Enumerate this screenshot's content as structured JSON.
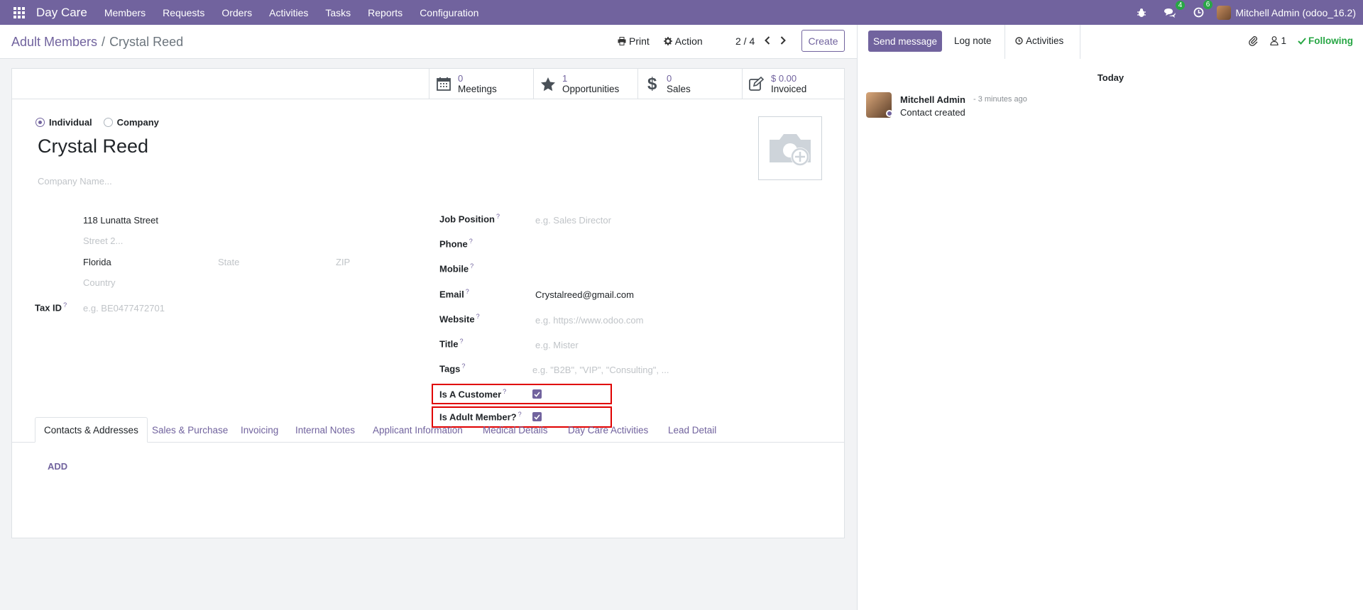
{
  "navbar": {
    "app_name": "Day Care",
    "menu": [
      "Members",
      "Requests",
      "Orders",
      "Activities",
      "Tasks",
      "Reports",
      "Configuration"
    ],
    "messages_count": "4",
    "activities_count": "6",
    "user": "Mitchell Admin (odoo_16.2)"
  },
  "control_panel": {
    "breadcrumb_parent": "Adult Members",
    "breadcrumb_sep": "/",
    "breadcrumb_current": "Crystal Reed",
    "print_label": "Print",
    "action_label": "Action",
    "pager": "2 / 4",
    "create_label": "Create"
  },
  "smart_buttons": [
    {
      "value": "0",
      "label": "Meetings"
    },
    {
      "value": "1",
      "label": "Opportunities"
    },
    {
      "value": "0",
      "label": "Sales"
    },
    {
      "value": "$ 0.00",
      "label": "Invoiced"
    }
  ],
  "form": {
    "type_individual": "Individual",
    "type_company": "Company",
    "name": "Crystal Reed",
    "company_name_placeholder": "Company Name...",
    "street": "118 Lunatta Street",
    "street2_placeholder": "Street 2...",
    "city": "Florida",
    "state_placeholder": "State",
    "zip_placeholder": "ZIP",
    "country_placeholder": "Country",
    "tax_id_label": "Tax ID",
    "tax_id_placeholder": "e.g. BE0477472701",
    "job_position_label": "Job Position",
    "job_position_placeholder": "e.g. Sales Director",
    "phone_label": "Phone",
    "mobile_label": "Mobile",
    "email_label": "Email",
    "email": "Crystalreed@gmail.com",
    "website_label": "Website",
    "website_placeholder": "e.g. https://www.odoo.com",
    "title_label": "Title",
    "title_placeholder": "e.g. Mister",
    "tags_label": "Tags",
    "tags_placeholder": "e.g. \"B2B\", \"VIP\", \"Consulting\", ...",
    "is_customer_label": "Is A Customer",
    "is_customer": true,
    "is_adult_member_label": "Is Adult Member?",
    "is_adult_member": true,
    "help_mark": "?"
  },
  "tabs": [
    "Contacts & Addresses",
    "Sales & Purchase",
    "Invoicing",
    "Internal Notes",
    "Applicant Information",
    "Medical Details",
    "Day Care Activities",
    "Lead Detail"
  ],
  "tab_content": {
    "add_label": "ADD"
  },
  "chatter": {
    "send_message": "Send message",
    "log_note": "Log note",
    "activities": "Activities",
    "followers_count": "1",
    "following": "Following",
    "day_label": "Today",
    "message_author": "Mitchell Admin",
    "message_time": "- 3 minutes ago",
    "message_body": "Contact created"
  },
  "colors": {
    "brand": "#71639e",
    "highlight": "#e00000",
    "following": "#28a745"
  }
}
